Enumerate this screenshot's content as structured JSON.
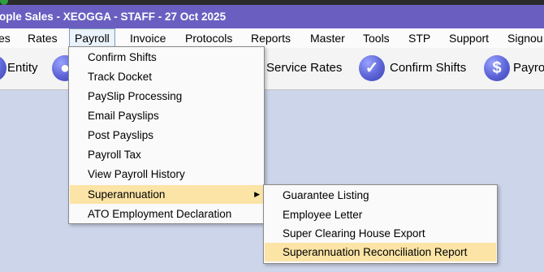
{
  "window": {
    "title": "ople Sales - XEOGGA - STAFF - 27 Oct 2025"
  },
  "menubar": {
    "items": [
      {
        "label": "es"
      },
      {
        "label": "Rates"
      },
      {
        "label": "Payroll"
      },
      {
        "label": "Invoice"
      },
      {
        "label": "Protocols"
      },
      {
        "label": "Reports"
      },
      {
        "label": "Master"
      },
      {
        "label": "Tools"
      },
      {
        "label": "STP"
      },
      {
        "label": "Support"
      },
      {
        "label": "Signou"
      }
    ],
    "active": "Payroll"
  },
  "toolbar": {
    "entity_label": "Entity",
    "service_rates_label": "Service Rates",
    "confirm_shifts_label": "Confirm Shifts",
    "payroll_label": "Payro",
    "confirm_icon": "checkmark-icon",
    "payroll_icon": "dollar-icon",
    "user_icon": "user-icon"
  },
  "payroll_menu": {
    "items": [
      {
        "label": "Confirm Shifts"
      },
      {
        "label": "Track Docket"
      },
      {
        "label": "PaySlip Processing"
      },
      {
        "label": "Email Payslips"
      },
      {
        "label": "Post Payslips"
      },
      {
        "label": "Payroll Tax"
      },
      {
        "label": "View Payroll History"
      },
      {
        "label": "Superannuation"
      },
      {
        "label": "ATO Employment Declaration"
      }
    ],
    "highlighted": "Superannuation"
  },
  "superannuation_submenu": {
    "items": [
      {
        "label": "Guarantee Listing"
      },
      {
        "label": "Employee Letter"
      },
      {
        "label": "Super Clearing House Export"
      },
      {
        "label": "Superannuation Reconciliation Report"
      }
    ],
    "highlighted": "Superannuation Reconciliation Report"
  },
  "colors": {
    "titlebar": "#6a5fc1",
    "highlight": "#fbe4a6",
    "desktop": "#cdd5ea"
  }
}
